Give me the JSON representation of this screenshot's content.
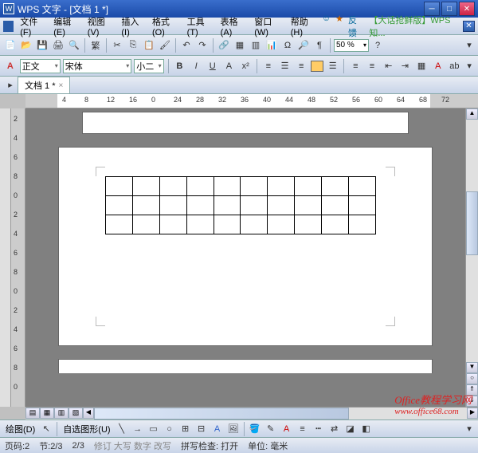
{
  "title": "WPS 文字 - [文档 1 *]",
  "menu": [
    "文件(F)",
    "编辑(E)",
    "视图(V)",
    "插入(I)",
    "格式(O)",
    "工具(T)",
    "表格(A)",
    "窗口(W)",
    "帮助(H)"
  ],
  "menulinks": {
    "feedback": "反馈",
    "promo": "【大话抢鲜版】WPS知..."
  },
  "zoom": "50 %",
  "format": {
    "style": "正文",
    "font": "宋体",
    "size": "小二"
  },
  "tab": {
    "label": "文档 1 *",
    "close": "×"
  },
  "ruler_h": [
    "4",
    "8",
    "12",
    "16",
    "0",
    "24",
    "28",
    "32",
    "36",
    "40",
    "44",
    "48",
    "52",
    "56",
    "60",
    "64",
    "68",
    "72"
  ],
  "ruler_v": [
    "2",
    "4",
    "6",
    "8",
    "0",
    "2",
    "4",
    "6",
    "8",
    "0",
    "2",
    "4",
    "6",
    "8",
    "0"
  ],
  "drawbar": {
    "draw": "绘图(D)",
    "autoshape": "自选图形(U)"
  },
  "status": {
    "page": "页码:2",
    "section": "节:2/3",
    "pages": "2/3",
    "rev": "修订 大写 数字 改写",
    "spell": "拼写检查: 打开",
    "unit": "单位: 毫米"
  },
  "chart_data": {
    "type": "table",
    "rows": 3,
    "cols": 10,
    "cells_empty": true
  },
  "watermark": {
    "line1": "Office教程学习网",
    "line2": "www.office68.com"
  }
}
